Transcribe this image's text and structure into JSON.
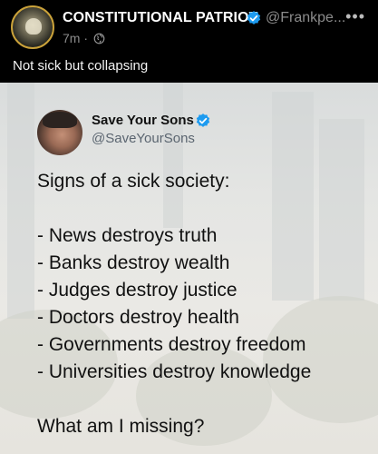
{
  "post": {
    "display_name": "CONSTITUTIONAL PATRIOT",
    "handle": "@Frankpe...",
    "time": "7m ·",
    "more_label": "•••",
    "caption": "Not sick but collapsing"
  },
  "embedded_tweet": {
    "name": "Save Your Sons",
    "handle": "@SaveYourSons",
    "lines": [
      "Signs of a sick society:",
      "",
      "- News destroys truth",
      "- Banks destroy wealth",
      "- Judges destroy justice",
      "- Doctors destroy health",
      "- Governments destroy freedom",
      "- Universities destroy knowledge",
      "",
      "What am I missing?"
    ]
  },
  "colors": {
    "background": "#000000",
    "verified_blue": "#1d9bf0",
    "muted_text": "#8b8b8b",
    "avatar_ring": "#caa23a"
  }
}
